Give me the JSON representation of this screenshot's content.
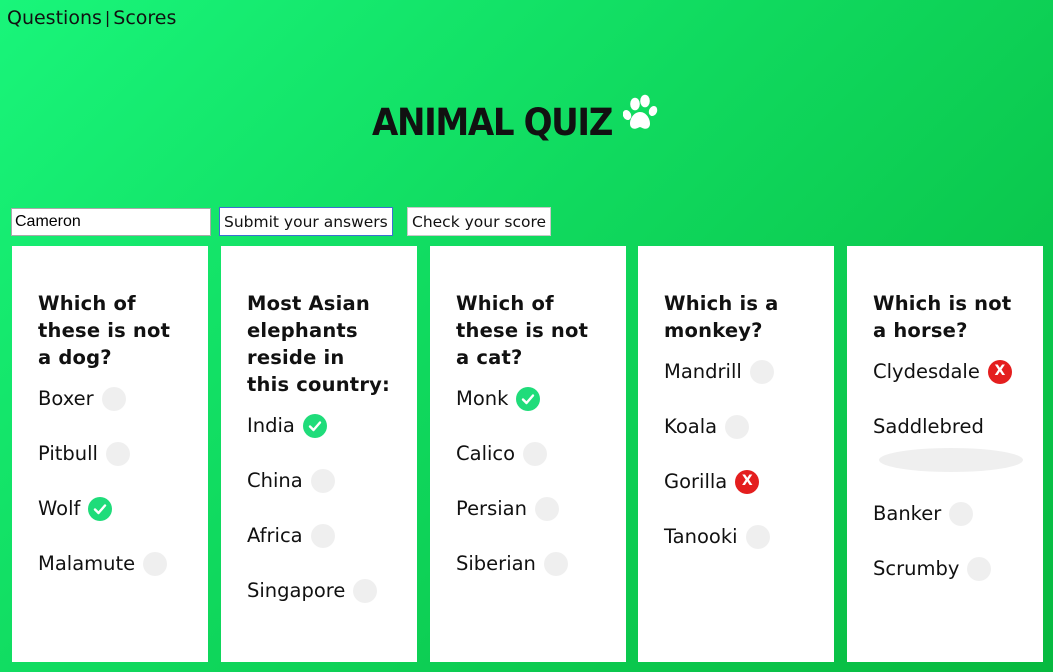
{
  "nav": {
    "questions": "Questions",
    "separator": "|",
    "scores": "Scores"
  },
  "title": "ANIMAL QUIZ",
  "name_input": {
    "value": "Cameron"
  },
  "buttons": {
    "submit": "Submit your answers",
    "score": "Check your score"
  },
  "cards": [
    {
      "question": "Which of these is not a dog?",
      "options": [
        {
          "label": "Boxer",
          "status": "empty"
        },
        {
          "label": "Pitbull",
          "status": "empty"
        },
        {
          "label": "Wolf",
          "status": "correct"
        },
        {
          "label": "Malamute",
          "status": "empty"
        }
      ]
    },
    {
      "question": "Most Asian elephants reside in this country:",
      "options": [
        {
          "label": "India",
          "status": "correct"
        },
        {
          "label": "China",
          "status": "empty"
        },
        {
          "label": "Africa",
          "status": "empty"
        },
        {
          "label": "Singapore",
          "status": "empty"
        }
      ]
    },
    {
      "question": "Which of these is not a cat?",
      "options": [
        {
          "label": "Monk",
          "status": "correct"
        },
        {
          "label": "Calico",
          "status": "empty"
        },
        {
          "label": "Persian",
          "status": "empty"
        },
        {
          "label": "Siberian",
          "status": "empty"
        }
      ]
    },
    {
      "question": "Which is a monkey?",
      "options": [
        {
          "label": "Mandrill",
          "status": "empty"
        },
        {
          "label": "Koala",
          "status": "empty"
        },
        {
          "label": "Gorilla",
          "status": "wrong",
          "mark_text": "X"
        },
        {
          "label": "Tanooki",
          "status": "empty"
        }
      ]
    },
    {
      "question": "Which is not a horse?",
      "options": [
        {
          "label": "Clydesdale",
          "status": "wrong",
          "mark_text": "X"
        },
        {
          "label": "Saddlebred",
          "status": "empty"
        },
        {
          "label": "Banker",
          "status": "empty"
        },
        {
          "label": "Scrumby",
          "status": "empty"
        }
      ]
    }
  ],
  "colors": {
    "correct": "#1fdc7a",
    "wrong": "#e41e1e",
    "unselected": "#efefef"
  },
  "icons": {
    "title_icon": "paw-icon",
    "correct_icon": "check-icon",
    "wrong_icon": "x-icon"
  }
}
